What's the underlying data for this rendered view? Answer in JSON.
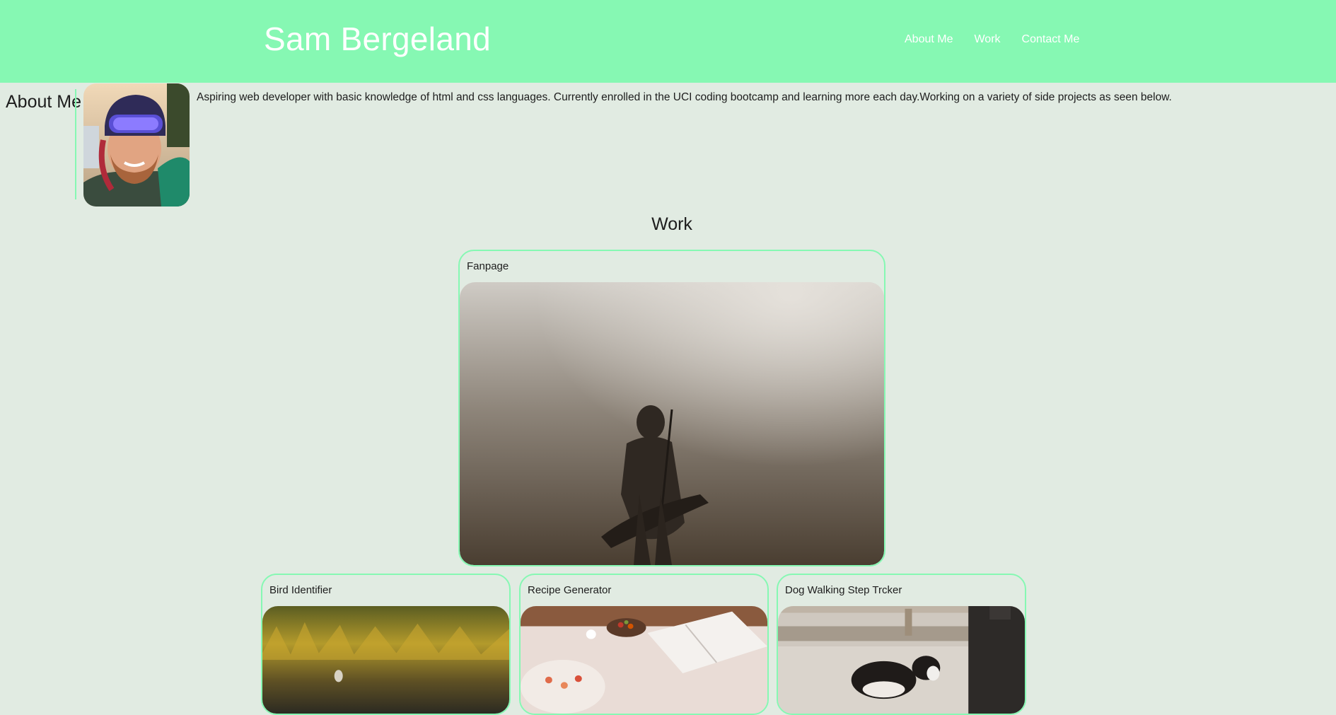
{
  "header": {
    "title": "Sam Bergeland",
    "nav": [
      {
        "label": "About Me"
      },
      {
        "label": "Work"
      },
      {
        "label": "Contact Me"
      }
    ]
  },
  "about": {
    "heading": "About Me",
    "text": "Aspiring web developer with basic knowledge of html and css languages. Currently enrolled in the UCI coding bootcamp and learning more each day.Working on a variety of side projects as seen below."
  },
  "work": {
    "heading": "Work",
    "featured": {
      "title": "Fanpage"
    },
    "projects": [
      {
        "title": "Bird Identifier"
      },
      {
        "title": "Recipe Generator"
      },
      {
        "title": "Dog Walking Step Trcker"
      }
    ]
  },
  "colors": {
    "header_bg": "#86f8b3",
    "page_bg": "#e1ebe2",
    "accent_border": "#86f8b3",
    "title_text": "#ffffff"
  }
}
